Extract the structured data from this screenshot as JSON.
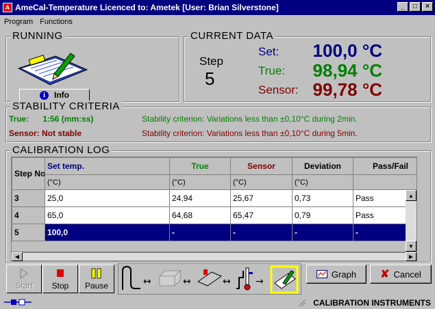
{
  "window": {
    "title": "AmeCal-Temperature Licenced to: Ametek [User: Brian Silverstone]",
    "buttons": [
      "_",
      "□",
      "×"
    ]
  },
  "menu": [
    {
      "label": "Program"
    },
    {
      "label": "Functions"
    }
  ],
  "running": {
    "title": "RUNNING",
    "info_label": "Info"
  },
  "current": {
    "title": "CURRENT DATA",
    "step_label": "Step",
    "step_value": "5",
    "set_label": "Set:",
    "set_value": "100,0 °C",
    "true_label": "True:",
    "true_value": "98,94 °C",
    "sensor_label": "Sensor:",
    "sensor_value": "99,78 °C",
    "colors": {
      "set": "#000080",
      "true": "#008000",
      "sensor": "#800000"
    }
  },
  "stability": {
    "title": "STABILITY CRITERIA",
    "true_status": "True:      1:56 (mm:ss)",
    "sensor_status": "Sensor: Not stable",
    "true_criterion": "Stability criterion: Variations less than ±0,10°C during 2min.",
    "sensor_criterion": "Stability criterion: Variations less than ±0,10°C during 5min."
  },
  "log": {
    "title": "CALIBRATION LOG",
    "headers": [
      "Step No.",
      "Set temp.",
      "True",
      "Sensor",
      "Deviation",
      "Pass/Fail"
    ],
    "units": [
      "(°C)",
      "(°C)",
      "(°C)",
      "(°C)",
      ""
    ],
    "rows": [
      {
        "step": "3",
        "set": "25,0",
        "true": "24,94",
        "sensor": "25,67",
        "deviation": "0,73",
        "result": "Pass"
      },
      {
        "step": "4",
        "set": "65,0",
        "true": "64,68",
        "sensor": "65,47",
        "deviation": "0,79",
        "result": "Pass"
      },
      {
        "step": "5",
        "set": "100,0",
        "true": "-",
        "sensor": "-",
        "deviation": "-",
        "result": "-"
      }
    ]
  },
  "toolbar": {
    "start_label": "Start",
    "stop_label": "Stop",
    "pause_label": "Pause",
    "graph_label": "Graph",
    "cancel_label": "Cancel"
  },
  "status": {
    "brand": "CALIBRATION INSTRUMENTS"
  }
}
